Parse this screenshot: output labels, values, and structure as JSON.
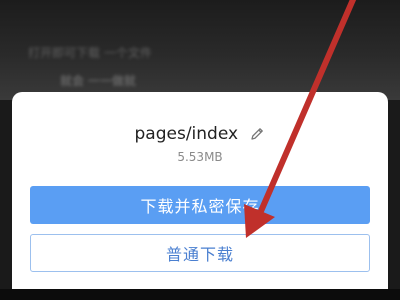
{
  "background": {
    "line1": "打开即可下载 一个文件",
    "line2": "就会 一一做就"
  },
  "sheet": {
    "file_name": "pages/index",
    "file_size": "5.53MB",
    "primary_button": "下载并私密保存",
    "secondary_button": "普通下载"
  },
  "colors": {
    "primary_button_bg": "#5a9ef3",
    "secondary_button_text": "#4a7fd0",
    "annotation_arrow": "#c0302b"
  },
  "icons": {
    "edit": "pencil-icon"
  }
}
